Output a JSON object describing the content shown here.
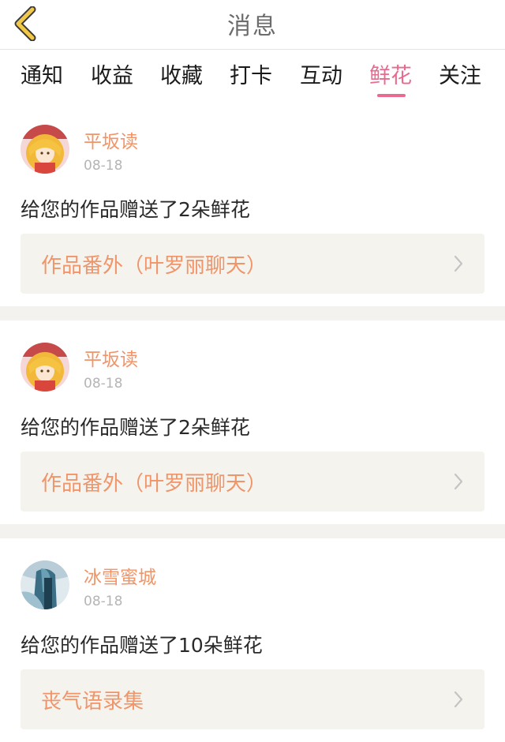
{
  "header": {
    "title": "消息"
  },
  "tabs": [
    {
      "label": "通知",
      "active": false
    },
    {
      "label": "收益",
      "active": false
    },
    {
      "label": "收藏",
      "active": false
    },
    {
      "label": "打卡",
      "active": false
    },
    {
      "label": "互动",
      "active": false
    },
    {
      "label": "鲜花",
      "active": true
    },
    {
      "label": "关注",
      "active": false
    }
  ],
  "colors": {
    "accent": "#e86a8e",
    "username": "#f0956a",
    "back_icon": "#f2c84b",
    "card_bg": "#f4f3ee"
  },
  "notifications": [
    {
      "username": "平坂读",
      "date": "08-18",
      "message": "给您的作品赠送了2朵鲜花",
      "work_title": "作品番外（叶罗丽聊天）",
      "avatar": "anime-girl-avatar"
    },
    {
      "username": "平坂读",
      "date": "08-18",
      "message": "给您的作品赠送了2朵鲜花",
      "work_title": "作品番外（叶罗丽聊天）",
      "avatar": "anime-girl-avatar"
    },
    {
      "username": "冰雪蜜城",
      "date": "08-18",
      "message": "给您的作品赠送了10朵鲜花",
      "work_title": "丧气语录集",
      "avatar": "blue-figure-avatar"
    }
  ]
}
